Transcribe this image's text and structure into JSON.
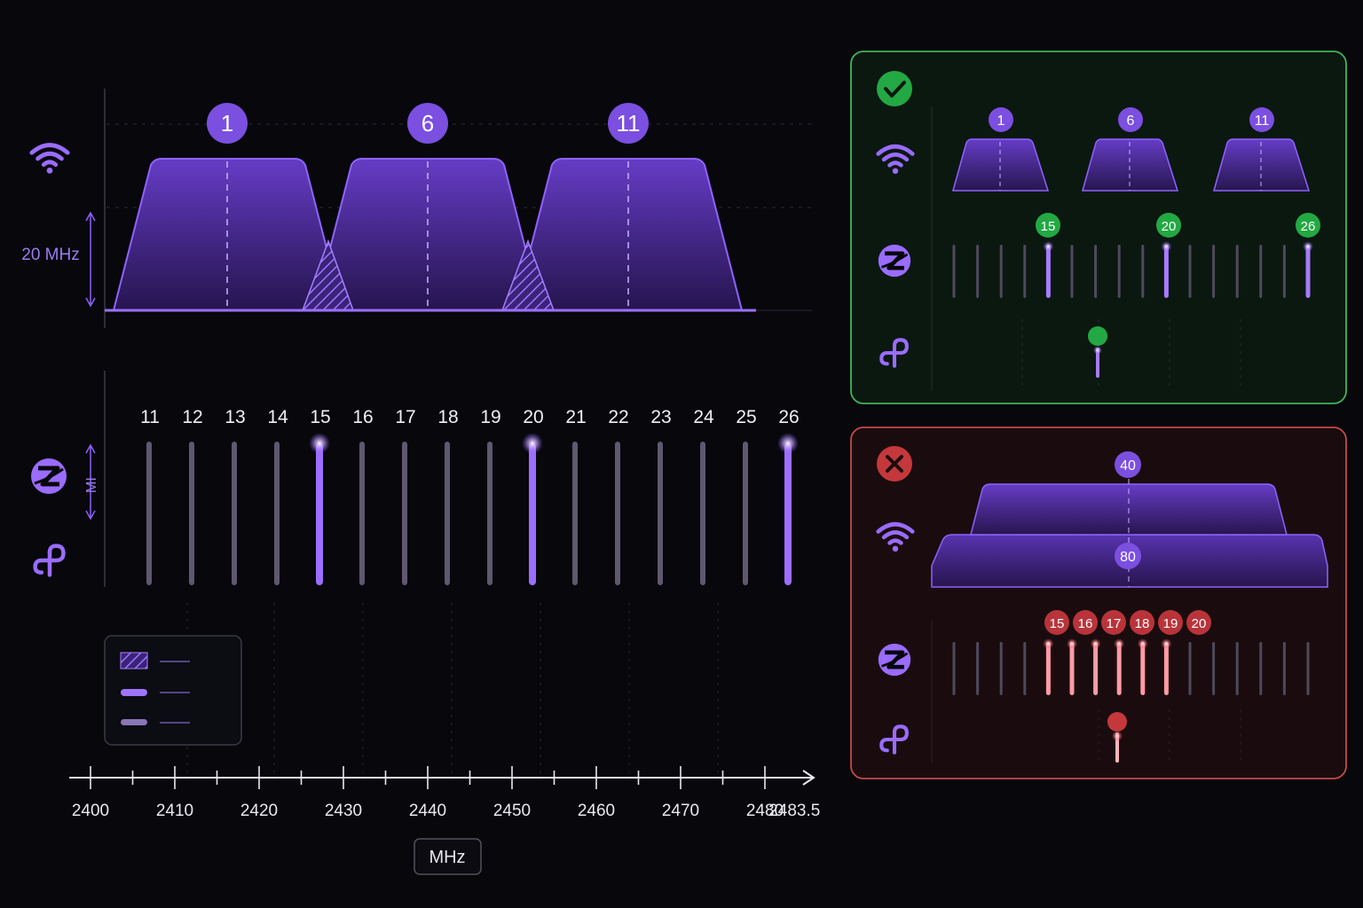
{
  "colors": {
    "background": "#07070c",
    "wifi_purple": "#7b4fe0",
    "channel_badge": "#7b4fe0",
    "zigbee_highlight": "#a77bff",
    "zigbee_bar": "#6a6376",
    "ok_green": "#23a943",
    "ok_border": "#3fb55a",
    "bad_red": "#c4383c",
    "bad_border": "#c44a4a"
  },
  "icons": {
    "wifi": "wifi-icon",
    "zigbee": "zigbee-icon",
    "thread": "thread-icon",
    "ok": "checkmark-icon",
    "bad": "cross-icon"
  },
  "main": {
    "bandwidth_label": "20 MHz",
    "mi_label": "MI",
    "wifi_channels": [
      "1",
      "6",
      "11"
    ],
    "zigbee_channels": [
      "11",
      "12",
      "13",
      "14",
      "15",
      "16",
      "17",
      "18",
      "19",
      "20",
      "21",
      "22",
      "23",
      "24",
      "25",
      "26"
    ],
    "highlighted_zigbee": [
      "15",
      "20",
      "26"
    ]
  },
  "axis": {
    "ticks": [
      "2400",
      "2410",
      "2420",
      "2430",
      "2440",
      "2450",
      "2460",
      "2470",
      "2480",
      "2483.5"
    ],
    "unit": "MHz"
  },
  "good_panel": {
    "wifi_channels": [
      "1",
      "6",
      "11"
    ],
    "zigbee_badges": [
      "15",
      "20",
      "26"
    ]
  },
  "bad_panel": {
    "wifi_top": "40",
    "wifi_bottom": "80",
    "zigbee_badges": [
      "15",
      "16",
      "17",
      "18",
      "19",
      "20"
    ]
  }
}
